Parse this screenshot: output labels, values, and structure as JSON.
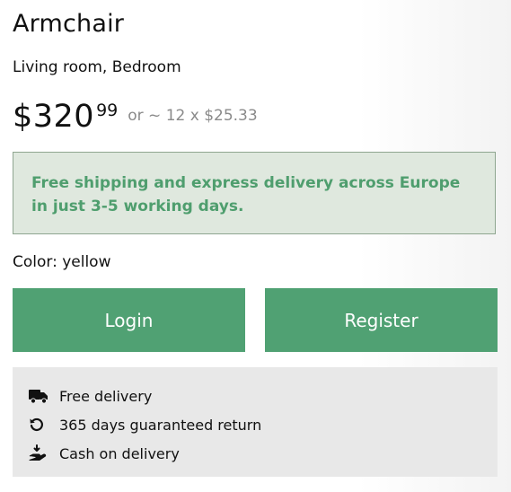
{
  "product": {
    "title": "Armchair",
    "category": "Living room, Bedroom",
    "price": {
      "main": "$320",
      "cents": "99",
      "installment": "or ~ 12 x $25.33"
    },
    "notice": "Free shipping and express delivery across Europe in just 3-5 working days.",
    "color_label": "Color: yellow"
  },
  "actions": {
    "login_label": "Login",
    "register_label": "Register"
  },
  "features": [
    {
      "icon": "truck-icon",
      "label": "Free delivery"
    },
    {
      "icon": "return-icon",
      "label": "365 days guaranteed return"
    },
    {
      "icon": "cash-hand-icon",
      "label": "Cash on delivery"
    }
  ],
  "colors": {
    "accent": "#50a173",
    "notice_bg": "#dfe8de",
    "notice_text": "#4f9e6e",
    "features_bg": "#e8e8e8"
  }
}
